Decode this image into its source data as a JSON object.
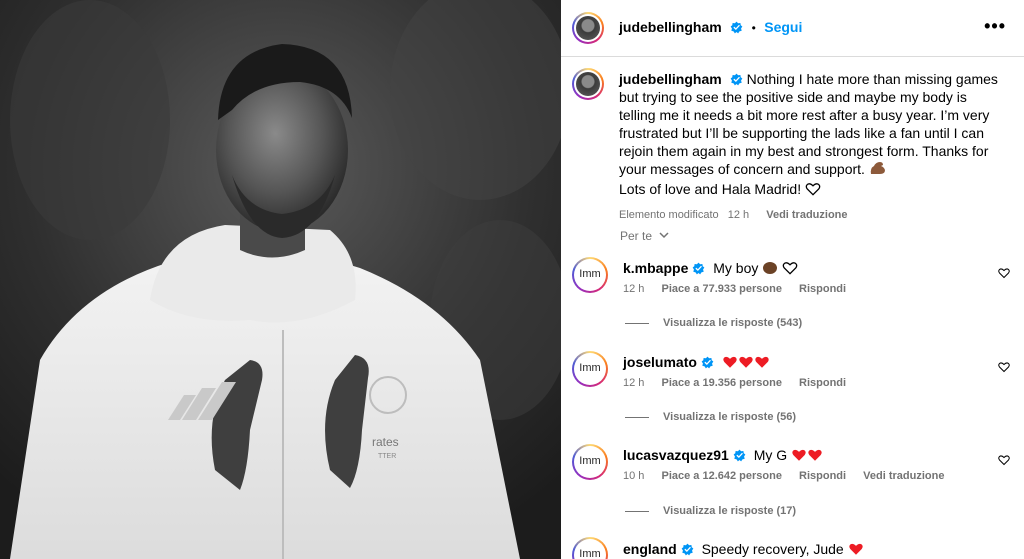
{
  "post": {
    "username": "jude​bellingham",
    "follow_label": "Segui",
    "separator": "•",
    "more_icon": "more-icon",
    "caption": {
      "username": "jude​bellingham",
      "line1": "Nothing I hate more than missing games but trying to see the positive side and maybe my body is telling me it needs a bit more rest after a busy year. I’m very frustrated but I’ll be supporting the lads like a fan until I can rejoin them again in my best and strongest form. Thanks for your messages of concern and support.",
      "line2": "Lots of love and Hala Madrid!",
      "edited": "Elemento modificato",
      "time": "12 h",
      "translate": "Vedi traduzione"
    },
    "see_all": "Per te"
  },
  "comments": [
    {
      "avatar_text": "Imm",
      "username": "k.mbappe",
      "text": "My boy",
      "time": "12 h",
      "likes": "Piace a 77.933 persone",
      "reply": "Rispondi",
      "translate": "",
      "view_replies": "Visualizza le risposte (543)"
    },
    {
      "avatar_text": "Imm",
      "username": "joselumato",
      "text": "",
      "time": "12 h",
      "likes": "Piace a 19.356 persone",
      "reply": "Rispondi",
      "translate": "",
      "view_replies": "Visualizza le risposte (56)"
    },
    {
      "avatar_text": "Imm",
      "username": "lucasvazquez91",
      "text": "My G",
      "time": "10 h",
      "likes": "Piace a 12.642 persone",
      "reply": "Rispondi",
      "translate": "Vedi traduzione",
      "view_replies": "Visualizza le risposte (17)"
    },
    {
      "avatar_text": "Imm",
      "username": "england",
      "text": "Speedy recovery, Jude",
      "time": "",
      "likes": "",
      "reply": "",
      "translate": "",
      "view_replies": ""
    }
  ],
  "photo": {
    "jacket_text": "Fly Emirates",
    "brand_line": "rates",
    "brand_sub": "TTER"
  },
  "colors": {
    "accent": "#0095f6",
    "verified": "#0095f6",
    "heart": "#ed1c24",
    "text": "#000000",
    "secondary": "#737373"
  }
}
